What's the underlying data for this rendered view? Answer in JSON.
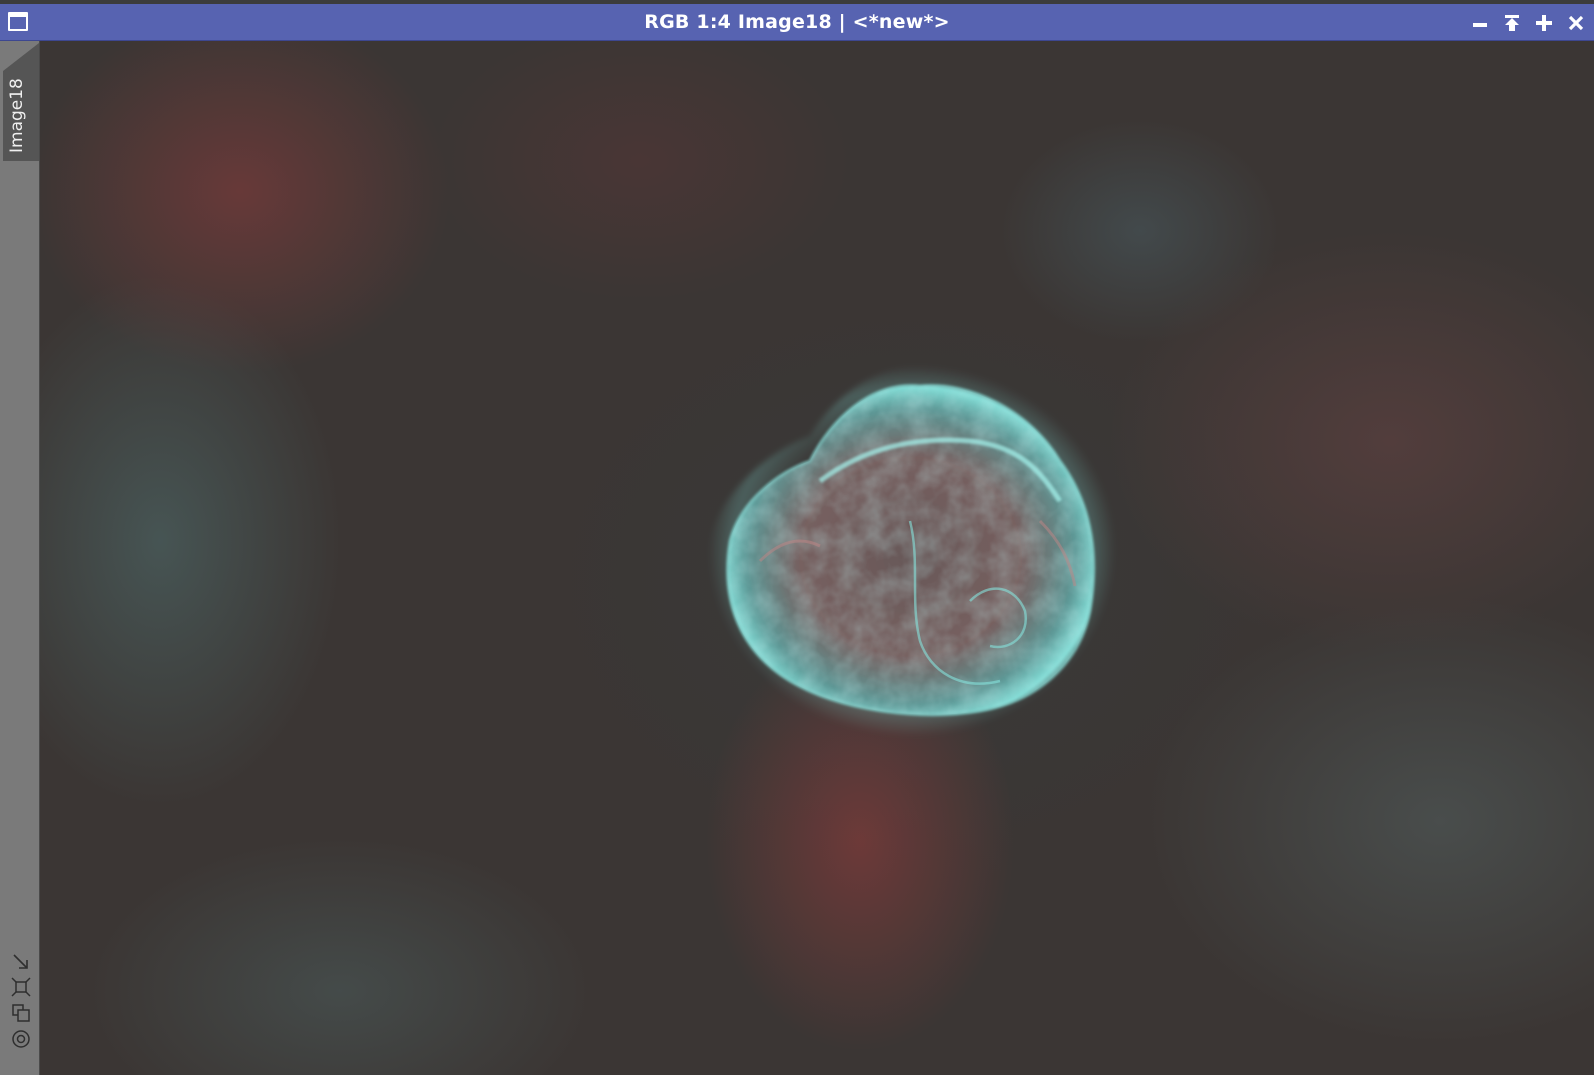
{
  "window": {
    "title": "RGB 1:4 Image18 | <*new*>",
    "system_icon": "window-icon",
    "buttons": {
      "minimize": "minimize-icon",
      "shade": "shade-icon",
      "maximize": "maximize-icon",
      "close": "close-icon"
    }
  },
  "side_panel": {
    "tab_label": "Image18",
    "tools": [
      "resize-arrow-icon",
      "fit-view-icon",
      "clone-icon",
      "target-icon"
    ]
  },
  "image": {
    "description_icon": "nebula-image",
    "colors": {
      "titlebar": "#5763b1",
      "background": "#3b3634",
      "nebula_shell": "#7fe6e0",
      "nebula_inner": "#b86a6a"
    }
  }
}
